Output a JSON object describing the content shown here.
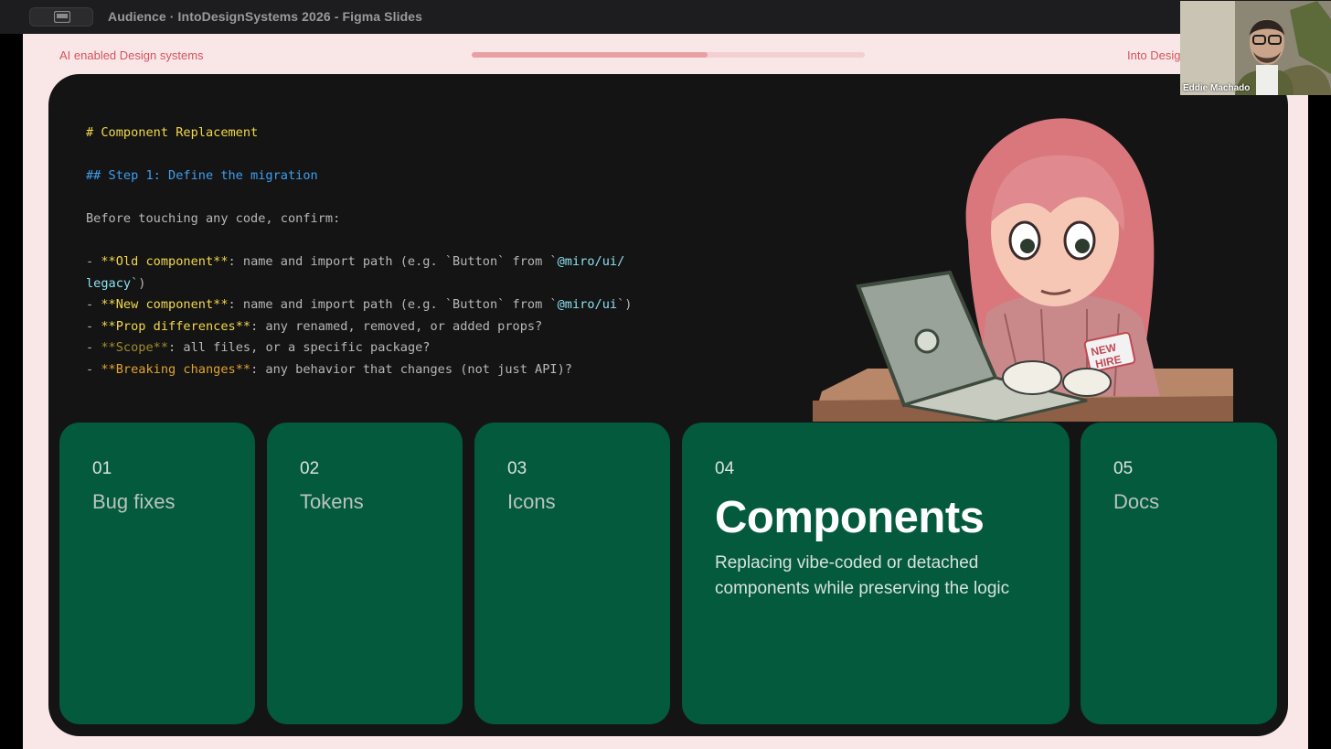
{
  "window": {
    "title": "Audience · IntoDesignSystems 2026 - Figma Slides"
  },
  "slide_header": {
    "left": "AI enabled Design systems",
    "right": "Into Desig",
    "progress": 0.6
  },
  "code_block": {
    "h1": "# Component Replacement",
    "h2": "## Step 1: Define the migration",
    "intro": "Before touching any code, confirm:",
    "items": [
      {
        "bullet": "- ",
        "bold": "**Old component**",
        "rest": ": name and import path (e.g. `Button` from `",
        "code": "@miro/ui/",
        "rest2": ""
      },
      {
        "bullet": "",
        "bold": "",
        "rest": "",
        "code": "legacy",
        "rest2": "`)"
      },
      {
        "bullet": "- ",
        "bold": "**New component**",
        "rest": ": name and import path (e.g. `Button` from `",
        "code": "@miro/ui",
        "rest2": "`)"
      },
      {
        "bullet": "- ",
        "bold": "**Prop differences**",
        "rest": ": any renamed, removed, or added props?",
        "code": "",
        "rest2": ""
      },
      {
        "bullet": "- ",
        "bold": "**Scope**",
        "rest": ": all files, or a specific package?",
        "code": "",
        "rest2": ""
      },
      {
        "bullet": "- ",
        "bold": "**Breaking changes**",
        "rest": ": any behavior that changes (not just API)?",
        "code": "",
        "rest2": ""
      }
    ]
  },
  "illustration": {
    "badge": [
      "NEW",
      "HIRE"
    ]
  },
  "tiles": [
    {
      "num": "01",
      "label": "Bug fixes"
    },
    {
      "num": "02",
      "label": "Tokens"
    },
    {
      "num": "03",
      "label": "Icons"
    },
    {
      "num": "04",
      "label": "Components",
      "desc": "Replacing vibe-coded or detached components while preserving the logic"
    },
    {
      "num": "05",
      "label": "Docs"
    }
  ],
  "video": {
    "participant": "Eddie Machado"
  },
  "colors": {
    "tile_bg": "#035a3d",
    "slide_bg": "#f9e7e8",
    "accent": "#d4555c"
  }
}
